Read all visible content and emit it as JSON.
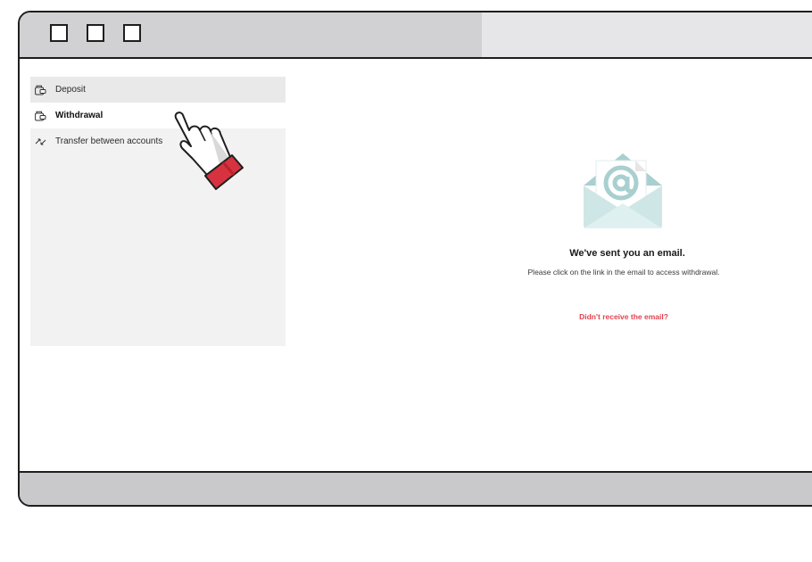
{
  "sidebar": {
    "items": [
      {
        "label": "Deposit",
        "icon": "wallet-icon"
      },
      {
        "label": "Withdrawal",
        "icon": "wallet-icon"
      },
      {
        "label": "Transfer between accounts",
        "icon": "transfer-arrows-icon"
      }
    ]
  },
  "message": {
    "title": "We've sent you an email.",
    "subtitle": "Please click on the link in the email to access withdrawal.",
    "resend_link": "Didn't receive the email?"
  },
  "colors": {
    "link": "#e0434f",
    "envelope": "#cfe6e6",
    "envelope_dark": "#a9cfd0",
    "cursor_cuff": "#d7323f"
  }
}
